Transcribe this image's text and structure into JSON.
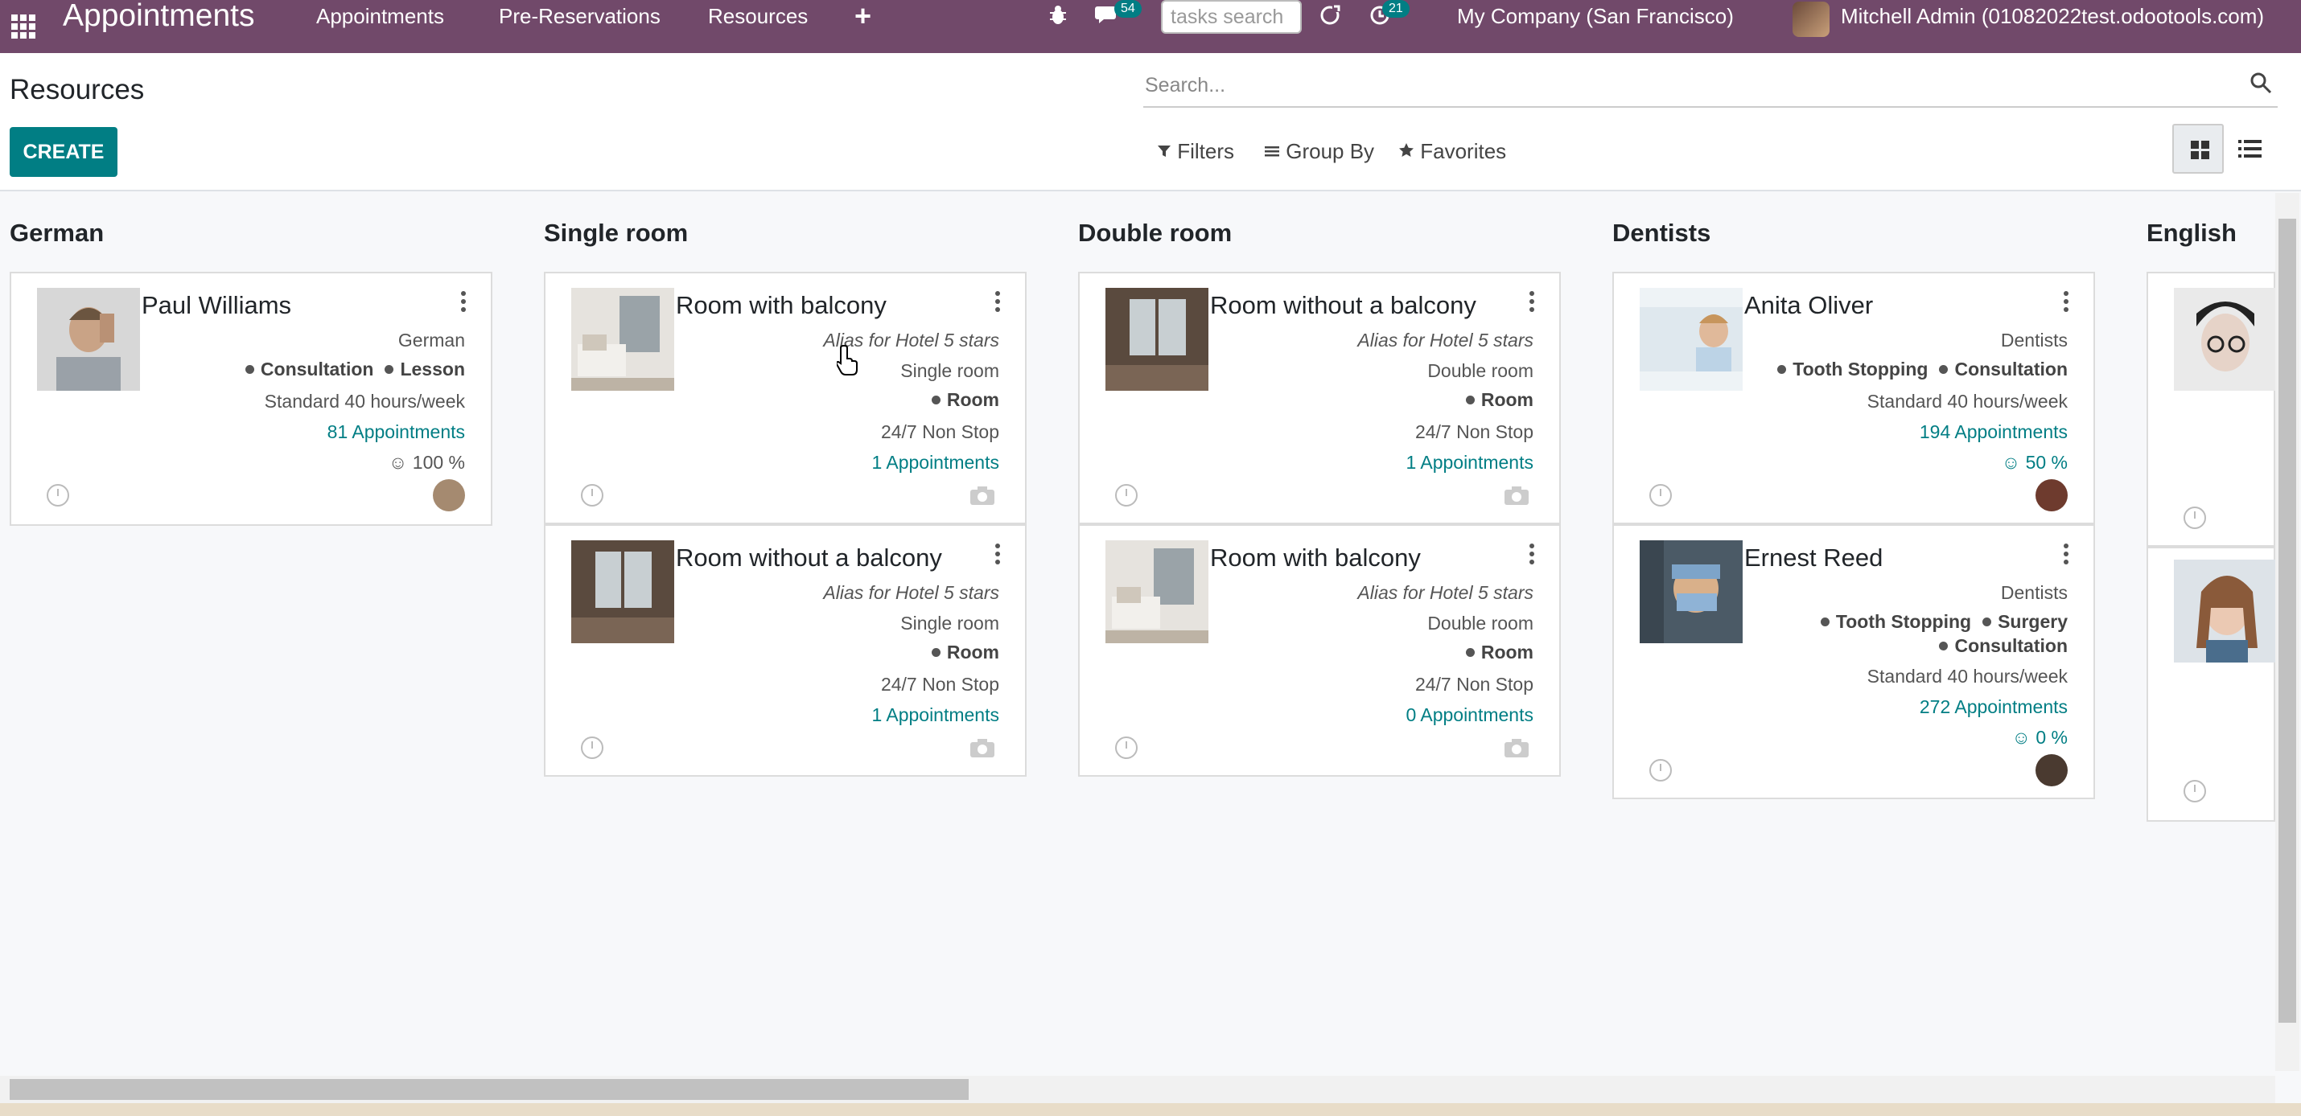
{
  "navbar": {
    "app_title": "Appointments",
    "menu": [
      "Appointments",
      "Pre-Reservations",
      "Resources"
    ],
    "plus_label": "+",
    "chat_badge": "54",
    "activity_badge": "21",
    "tasks_search_placeholder": "tasks search",
    "company": "My Company (San Francisco)",
    "user": "Mitchell Admin (01082022test.odootools.com)"
  },
  "control_panel": {
    "title": "Resources",
    "create_label": "CREATE",
    "search_placeholder": "Search...",
    "filters_label": "Filters",
    "group_by_label": "Group By",
    "favorites_label": "Favorites"
  },
  "columns": [
    {
      "title": "German",
      "cards": [
        {
          "name": "Paul Williams",
          "lines": [
            "German"
          ],
          "tags": [
            "Consultation",
            "Lesson"
          ],
          "schedule": "Standard 40 hours/week",
          "appointments": "81 Appointments",
          "rating": "100 %"
        }
      ]
    },
    {
      "title": "Single room",
      "cards": [
        {
          "name": "Room with balcony",
          "alias": "Alias for Hotel 5 stars",
          "lines": [
            "Single room"
          ],
          "tags": [
            "Room"
          ],
          "schedule": "24/7 Non Stop",
          "appointments": "1 Appointments"
        },
        {
          "name": "Room without a balcony",
          "alias": "Alias for Hotel 5 stars",
          "lines": [
            "Single room"
          ],
          "tags": [
            "Room"
          ],
          "schedule": "24/7 Non Stop",
          "appointments": "1 Appointments"
        }
      ]
    },
    {
      "title": "Double room",
      "cards": [
        {
          "name": "Room without a balcony",
          "alias": "Alias for Hotel 5 stars",
          "lines": [
            "Double room"
          ],
          "tags": [
            "Room"
          ],
          "schedule": "24/7 Non Stop",
          "appointments": "1 Appointments"
        },
        {
          "name": "Room with balcony",
          "alias": "Alias for Hotel 5 stars",
          "lines": [
            "Double room"
          ],
          "tags": [
            "Room"
          ],
          "schedule": "24/7 Non Stop",
          "appointments": "0 Appointments"
        }
      ]
    },
    {
      "title": "Dentists",
      "cards": [
        {
          "name": "Anita Oliver",
          "lines": [
            "Dentists"
          ],
          "tags": [
            "Tooth Stopping",
            "Consultation"
          ],
          "schedule": "Standard 40 hours/week",
          "appointments": "194 Appointments",
          "rating": "50 %"
        },
        {
          "name": "Ernest Reed",
          "lines": [
            "Dentists"
          ],
          "tags": [
            "Tooth Stopping",
            "Surgery"
          ],
          "tags2": [
            "Consultation"
          ],
          "schedule": "Standard 40 hours/week",
          "appointments": "272 Appointments",
          "rating": "0 %"
        }
      ]
    },
    {
      "title": "English",
      "cards": []
    }
  ],
  "colors": {
    "navbar": "#71496a",
    "primary": "#017e84"
  }
}
